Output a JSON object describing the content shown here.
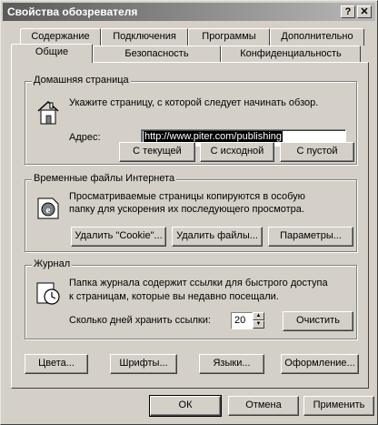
{
  "window": {
    "title": "Свойства обозревателя",
    "help_button": "?",
    "close_button": "✕"
  },
  "tabs": {
    "back_row": [
      "Содержание",
      "Подключения",
      "Программы",
      "Дополнительно"
    ],
    "front_row": [
      "Общие",
      "Безопасность",
      "Конфиденциальность"
    ],
    "active": "Общие"
  },
  "home": {
    "legend": "Домашняя страница",
    "description": "Укажите страницу, с которой следует начинать обзор.",
    "address_label": "Адрес:",
    "address_value": "http://www.piter.com/publishing",
    "buttons": [
      "С текущей",
      "С исходной",
      "С пустой"
    ]
  },
  "temp_files": {
    "legend": "Временные файлы Интернета",
    "description_line1": "Просматриваемые страницы копируются в особую",
    "description_line2": "папку для ускорения их последующего просмотра.",
    "buttons": [
      "Удалить \"Cookie\"...",
      "Удалить файлы...",
      "Параметры..."
    ]
  },
  "history": {
    "legend": "Журнал",
    "description_line1": "Папка журнала содержит ссылки для быстрого доступа",
    "description_line2": "к страницам, которые вы недавно посещали.",
    "days_label": "Сколько дней хранить ссылки:",
    "days_value": "20",
    "clear_button": "Очистить"
  },
  "bottom_panel_buttons": [
    "Цвета...",
    "Шрифты...",
    "Языки...",
    "Оформление..."
  ],
  "dialog_buttons": {
    "ok": "ОК",
    "cancel": "Отмена",
    "apply": "Применить"
  }
}
